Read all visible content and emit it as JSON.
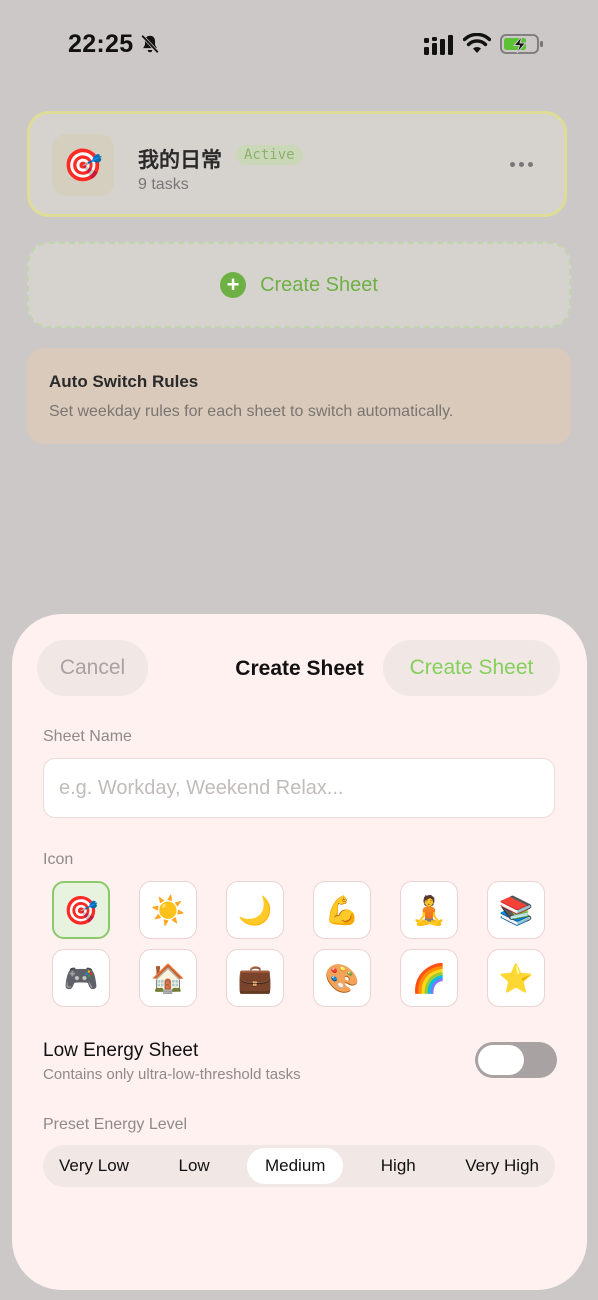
{
  "status_bar": {
    "time": "22:25",
    "icons": [
      "bell-slash-icon",
      "cellular-signal-icon",
      "wifi-icon",
      "battery-charging-icon"
    ],
    "battery_color": "#5bc236"
  },
  "background": {
    "sheet_card": {
      "icon": "🎯",
      "name": "我的日常",
      "badge": "Active",
      "subtitle": "9 tasks",
      "more_icon": "ellipsis-icon"
    },
    "create_card": {
      "label": "Create Sheet"
    },
    "rules_card": {
      "title": "Auto Switch Rules",
      "description": "Set weekday rules for each sheet to switch automatically."
    }
  },
  "modal": {
    "cancel_label": "Cancel",
    "title": "Create Sheet",
    "create_label": "Create Sheet",
    "sheet_name_label": "Sheet Name",
    "sheet_name_placeholder": "e.g. Workday, Weekend Relax...",
    "sheet_name_value": "",
    "icon_label": "Icon",
    "icons": [
      "🎯",
      "☀️",
      "🌙",
      "💪",
      "🧘",
      "📚",
      "🎮",
      "🏠",
      "💼",
      "🎨",
      "🌈",
      "⭐"
    ],
    "selected_icon_index": 0,
    "low_energy": {
      "title": "Low Energy Sheet",
      "subtitle": "Contains only ultra-low-threshold tasks",
      "enabled": false
    },
    "energy_label": "Preset Energy Level",
    "energy_levels": [
      "Very Low",
      "Low",
      "Medium",
      "High",
      "Very High"
    ],
    "selected_energy": "Medium"
  },
  "colors": {
    "accent_green": "#6db043",
    "active_border": "#dedd97"
  }
}
